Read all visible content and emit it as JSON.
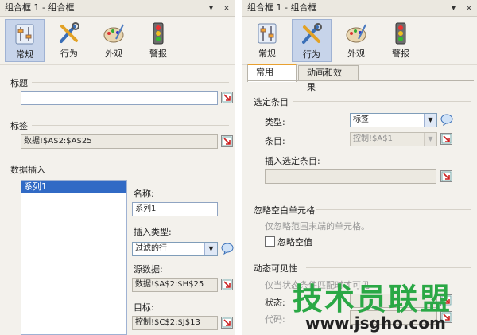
{
  "left": {
    "title": "组合框 1 - 组合框",
    "pin": "ꟹ",
    "close": "×",
    "tabs": [
      "常规",
      "行为",
      "外观",
      "警报"
    ],
    "title_section": "标题",
    "title_value": "",
    "label_section": "标签",
    "label_value": "数据!$A$2:$A$25",
    "data_insert_section": "数据插入",
    "series_item": "系列1",
    "name_label": "名称:",
    "name_value": "系列1",
    "insert_type_label": "插入类型:",
    "insert_type_value": "过滤的行",
    "source_label": "源数据:",
    "source_value": "数据!$A$2:$H$25",
    "target_label": "目标:",
    "target_value": "控制!$C$2:$J$13"
  },
  "right": {
    "title": "组合框 1 - 组合框",
    "pin": "ꟹ",
    "close": "×",
    "tabs": [
      "常规",
      "行为",
      "外观",
      "警报"
    ],
    "subtabs": [
      "常用",
      "动画和效果"
    ],
    "selected_item_section": "选定条目",
    "type_label": "类型:",
    "type_value": "标签",
    "item_label": "条目:",
    "item_value": "控制!$A$1",
    "insert_selected_label": "插入选定条目:",
    "insert_selected_value": "",
    "ignore_blank_section": "忽略空白单元格",
    "ignore_blank_desc": "仅忽略范围末端的单元格。",
    "ignore_blank_checkbox": "忽略空值",
    "dynamic_section": "动态可见性",
    "dynamic_desc": "仅当状态条件匹配时才可见",
    "state_label": "状态:",
    "code_label": "代码:"
  },
  "watermark": {
    "text": "技术员联盟",
    "url": "www.jsgho.com"
  }
}
